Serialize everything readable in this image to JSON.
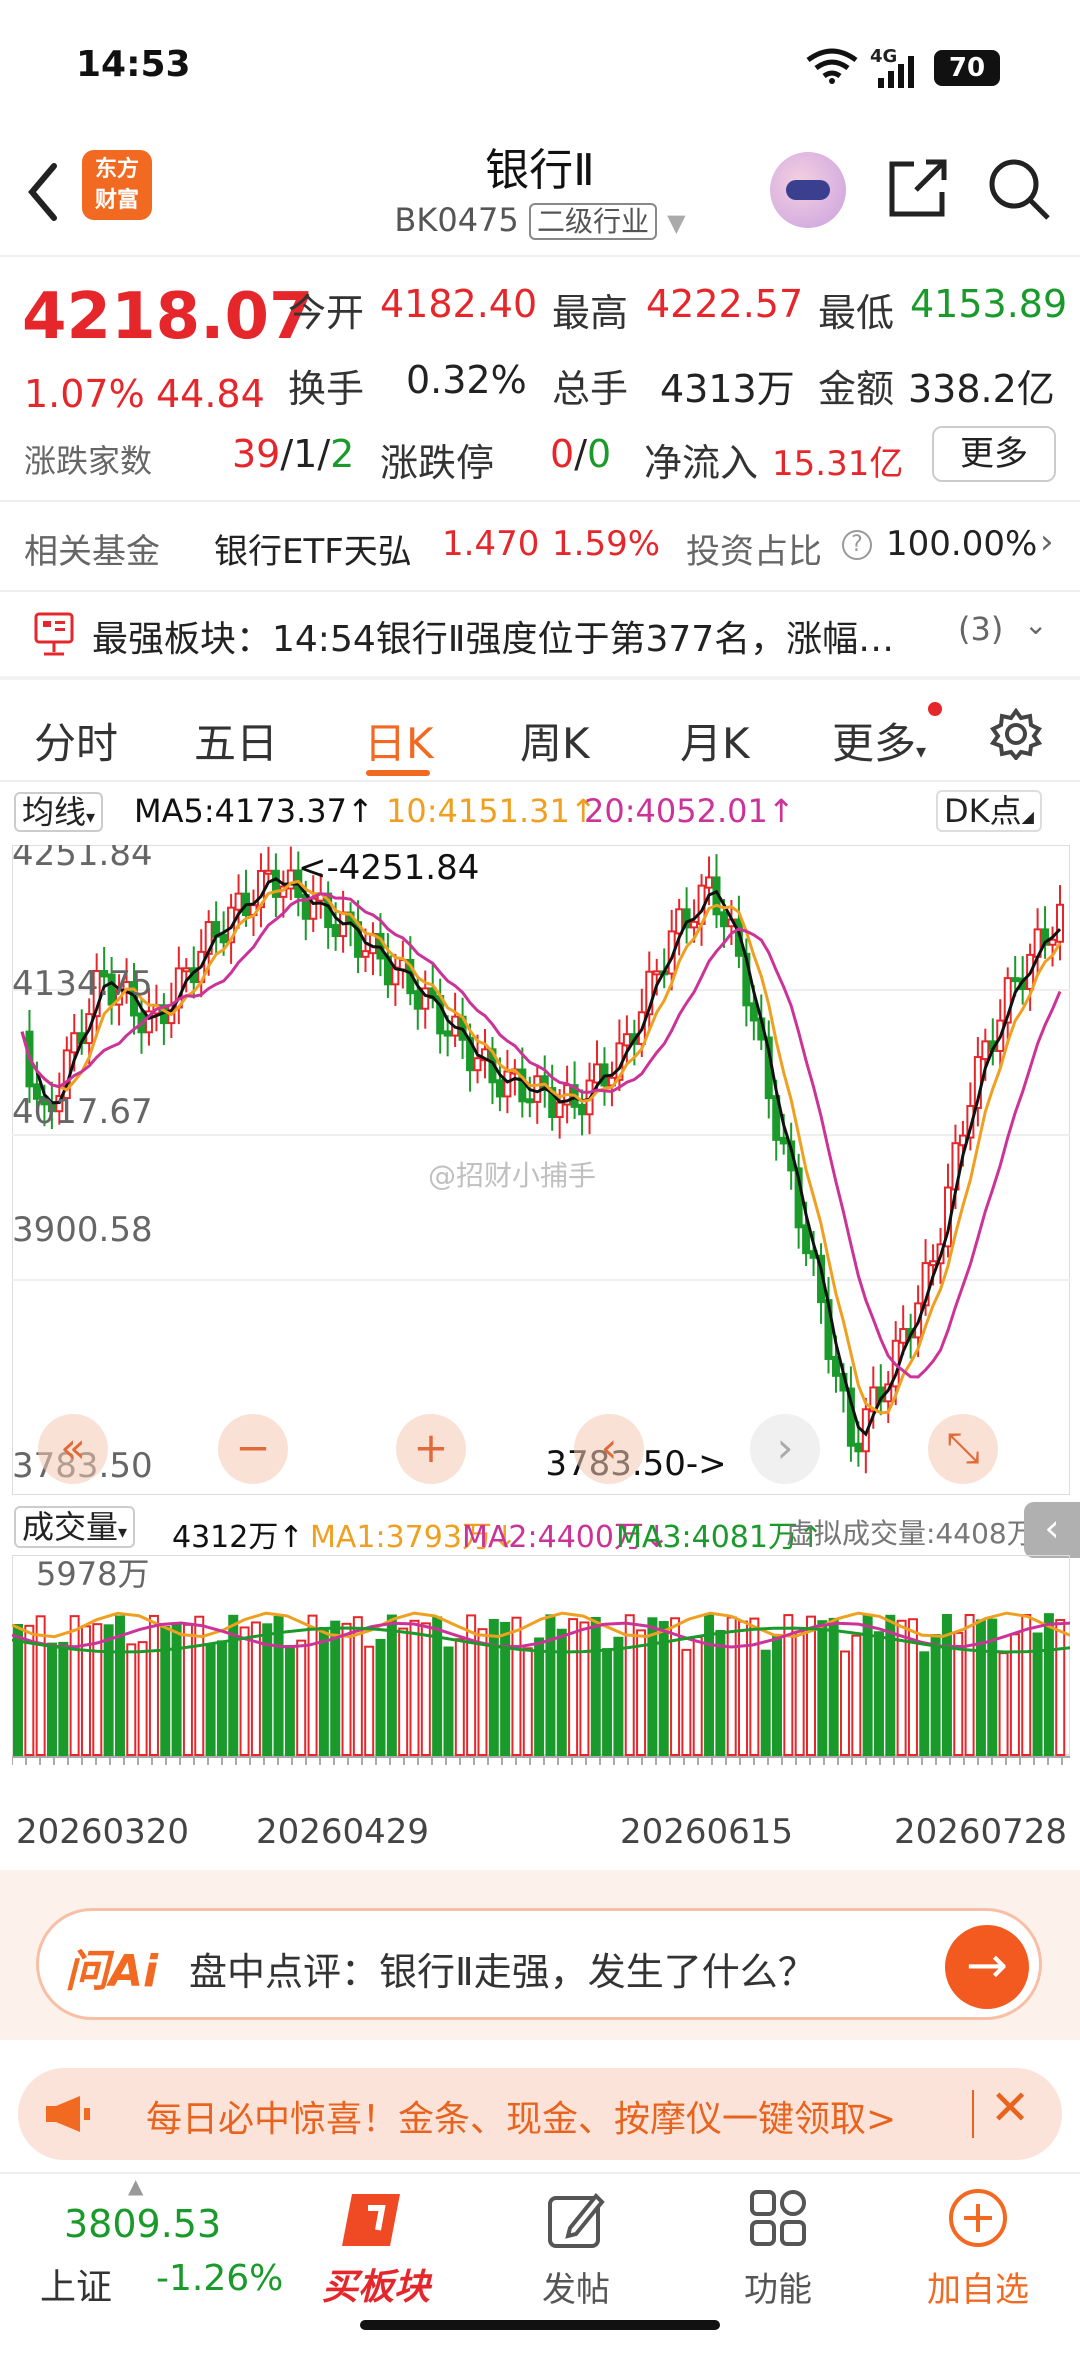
{
  "status": {
    "time": "14:53",
    "battery": "70",
    "network": "4G"
  },
  "header": {
    "title": "银行Ⅱ",
    "code": "BK0475",
    "category": "二级行业",
    "logo_line1": "东方",
    "logo_line2": "财富"
  },
  "quote": {
    "price": "4218.07",
    "change_pct": "1.07%",
    "change_abs": "44.84",
    "open_label": "今开",
    "open": "4182.40",
    "high_label": "最高",
    "high": "4222.57",
    "low_label": "最低",
    "low": "4153.89",
    "turnover_label": "换手",
    "turnover": "0.32%",
    "volume_label": "总手",
    "volume": "4313万",
    "amount_label": "金额",
    "amount": "338.2亿",
    "breadth_label": "涨跌家数",
    "breadth_up": "39",
    "breadth_flat": "1",
    "breadth_down": "2",
    "limit_label": "涨跌停",
    "limit_up": "0",
    "limit_down": "0",
    "inflow_label": "净流入",
    "inflow": "15.31亿",
    "more_label": "更多"
  },
  "fund": {
    "label": "相关基金",
    "name": "银行ETF天弘",
    "price": "1.470",
    "pct": "1.59%",
    "ratio_label": "投资占比",
    "ratio": "100.00%"
  },
  "notice": {
    "text": "最强板块：14:54银行Ⅱ强度位于第377名，涨幅…",
    "count": "(3)"
  },
  "tabs": [
    "分时",
    "五日",
    "日K",
    "周K",
    "月K",
    "更多"
  ],
  "ma": {
    "selector": "均线",
    "ma5": "MA5:4173.37↑",
    "ma10": "10:4151.31↑",
    "ma20": "20:4052.01↑",
    "dk": "DK点"
  },
  "yaxis": [
    "4251.84",
    "4134.75",
    "4017.67",
    "3900.58",
    "3783.50"
  ],
  "annotations": {
    "high": "<-4251.84",
    "low": "3783.50->"
  },
  "watermark": "@招财小捕手",
  "volume": {
    "selector": "成交量",
    "current": "4312万↑",
    "ma1": "MA1:3793万↓",
    "ma2": "MA2:4400万↓",
    "ma3": "MA3:4081万↑",
    "virtual": "虚拟成交量:4408万",
    "max": "5978万"
  },
  "dates": [
    "20260320",
    "20260429",
    "20260615",
    "20260728"
  ],
  "ai": {
    "logo": "问Ai",
    "text": "盘中点评：银行Ⅱ走强，发生了什么？"
  },
  "promo": {
    "text": "每日必中惊喜！金条、现金、按摩仪一键领取>"
  },
  "bottomnav": {
    "index_value": "3809.53",
    "index_name": "上证",
    "index_pct": "-1.26%",
    "buy": "买板块",
    "post": "发帖",
    "func": "功能",
    "add": "加自选"
  },
  "colors": {
    "up": "#e5272c",
    "down": "#1a9a2a",
    "accent": "#f26a21",
    "ma5": "#111111",
    "ma10": "#f0a020",
    "ma20": "#cc3399"
  }
}
